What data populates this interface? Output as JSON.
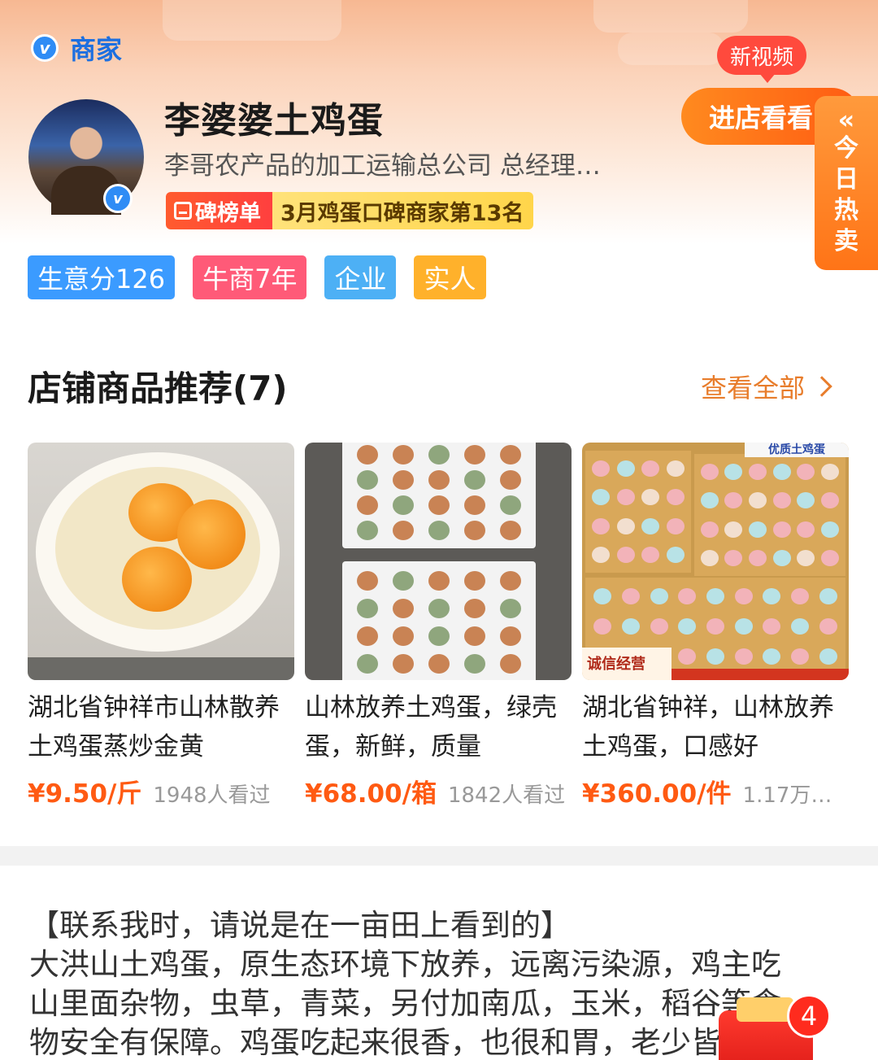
{
  "header": {
    "merchant_label": "商家",
    "shop_name": "李婆婆土鸡蛋",
    "subtitle": "李哥农产品的加工运输总公司  总经理…",
    "rank_left": "碑榜单",
    "rank_right": "3月鸡蛋口碑商家第13名",
    "tags": [
      "生意分126",
      "牛商7年",
      "企业",
      "实人"
    ],
    "new_video_label": "新视频",
    "enter_shop_label": "进店看看",
    "hot_side_label": "今日热卖",
    "v_mark": "v"
  },
  "recommend": {
    "title": "店铺商品推荐(7)",
    "view_all": "查看全部",
    "products": [
      {
        "title": "湖北省钟祥市山林散养土鸡蛋蒸炒金黄",
        "price": "¥9.50/斤",
        "views": "1948人看过"
      },
      {
        "title": "山林放养土鸡蛋，绿壳蛋，新鲜，质量",
        "price": "¥68.00/箱",
        "views": "1842人看过"
      },
      {
        "title": "湖北省钟祥，山林放养土鸡蛋，口感好",
        "price": "¥360.00/件",
        "views": "1.17万…"
      }
    ],
    "thumb3_tag": "诚信经营",
    "thumb3_banner": "优质土鸡蛋"
  },
  "description": {
    "lines": [
      "【联系我时，请说是在一亩田上看到的】",
      "大洪山土鸡蛋，原生态环境下放养，远离污染源，鸡主吃",
      "山里面杂物，虫草，青菜，另付加南瓜，玉米，稻谷等食",
      "物安全有保障。鸡蛋吃起来很香，也很和胃，老少皆宜有"
    ]
  },
  "floating": {
    "badge_count": "4"
  },
  "colors": {
    "accent": "#ff5a12",
    "brand_blue": "#2f8cf5",
    "link_orange": "#e87d2c"
  }
}
